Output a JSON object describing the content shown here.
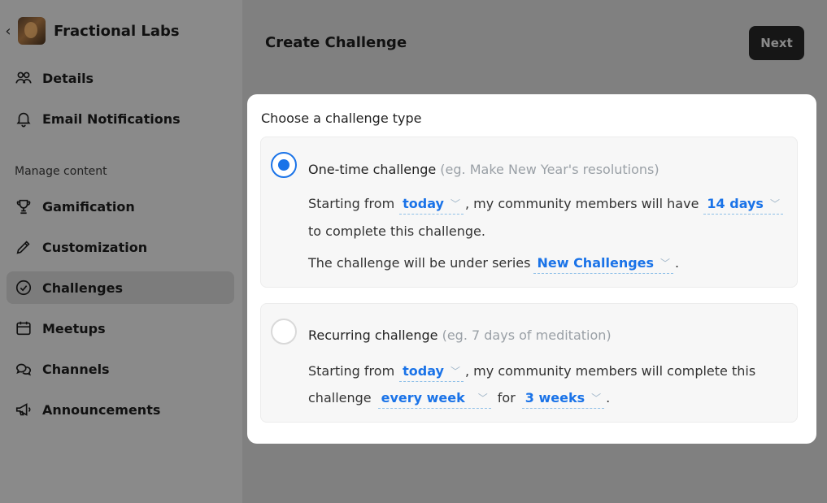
{
  "sidebar": {
    "brand_name": "Fractional Labs",
    "items_top": [
      {
        "label": "Details",
        "icon": "users-icon"
      },
      {
        "label": "Email Notifications",
        "icon": "bell-icon"
      }
    ],
    "section_label": "Manage content",
    "items": [
      {
        "label": "Gamification",
        "icon": "trophy-icon"
      },
      {
        "label": "Customization",
        "icon": "pencil-icon"
      },
      {
        "label": "Challenges",
        "icon": "check-circle-icon",
        "active": true
      },
      {
        "label": "Meetups",
        "icon": "calendar-icon"
      },
      {
        "label": "Channels",
        "icon": "chat-icon"
      },
      {
        "label": "Announcements",
        "icon": "megaphone-icon"
      }
    ]
  },
  "header": {
    "title": "Create Challenge",
    "next_label": "Next"
  },
  "modal": {
    "title": "Choose a challenge type",
    "one_time": {
      "title": "One-time challenge",
      "hint": "(eg. Make New Year's resolutions)",
      "selected": true,
      "line1_prefix": "Starting from",
      "start": "today",
      "line1_mid": ", my community members will have",
      "duration": "14 days",
      "line2": "to complete this challenge.",
      "line3_prefix": "The challenge will be under series",
      "series": "New Challenges",
      "line3_suffix": "."
    },
    "recurring": {
      "title": "Recurring challenge",
      "hint": "(eg. 7 days of meditation)",
      "selected": false,
      "line1_prefix": "Starting from",
      "start": "today",
      "line1_mid": ", my community members will complete this",
      "line2_prefix": "challenge",
      "frequency": "every week",
      "line2_mid": "for",
      "period": "3 weeks",
      "line2_suffix": "."
    }
  },
  "colors": {
    "accent": "#1a73e8",
    "overlay": "#808080",
    "button_bg": "#161616"
  }
}
